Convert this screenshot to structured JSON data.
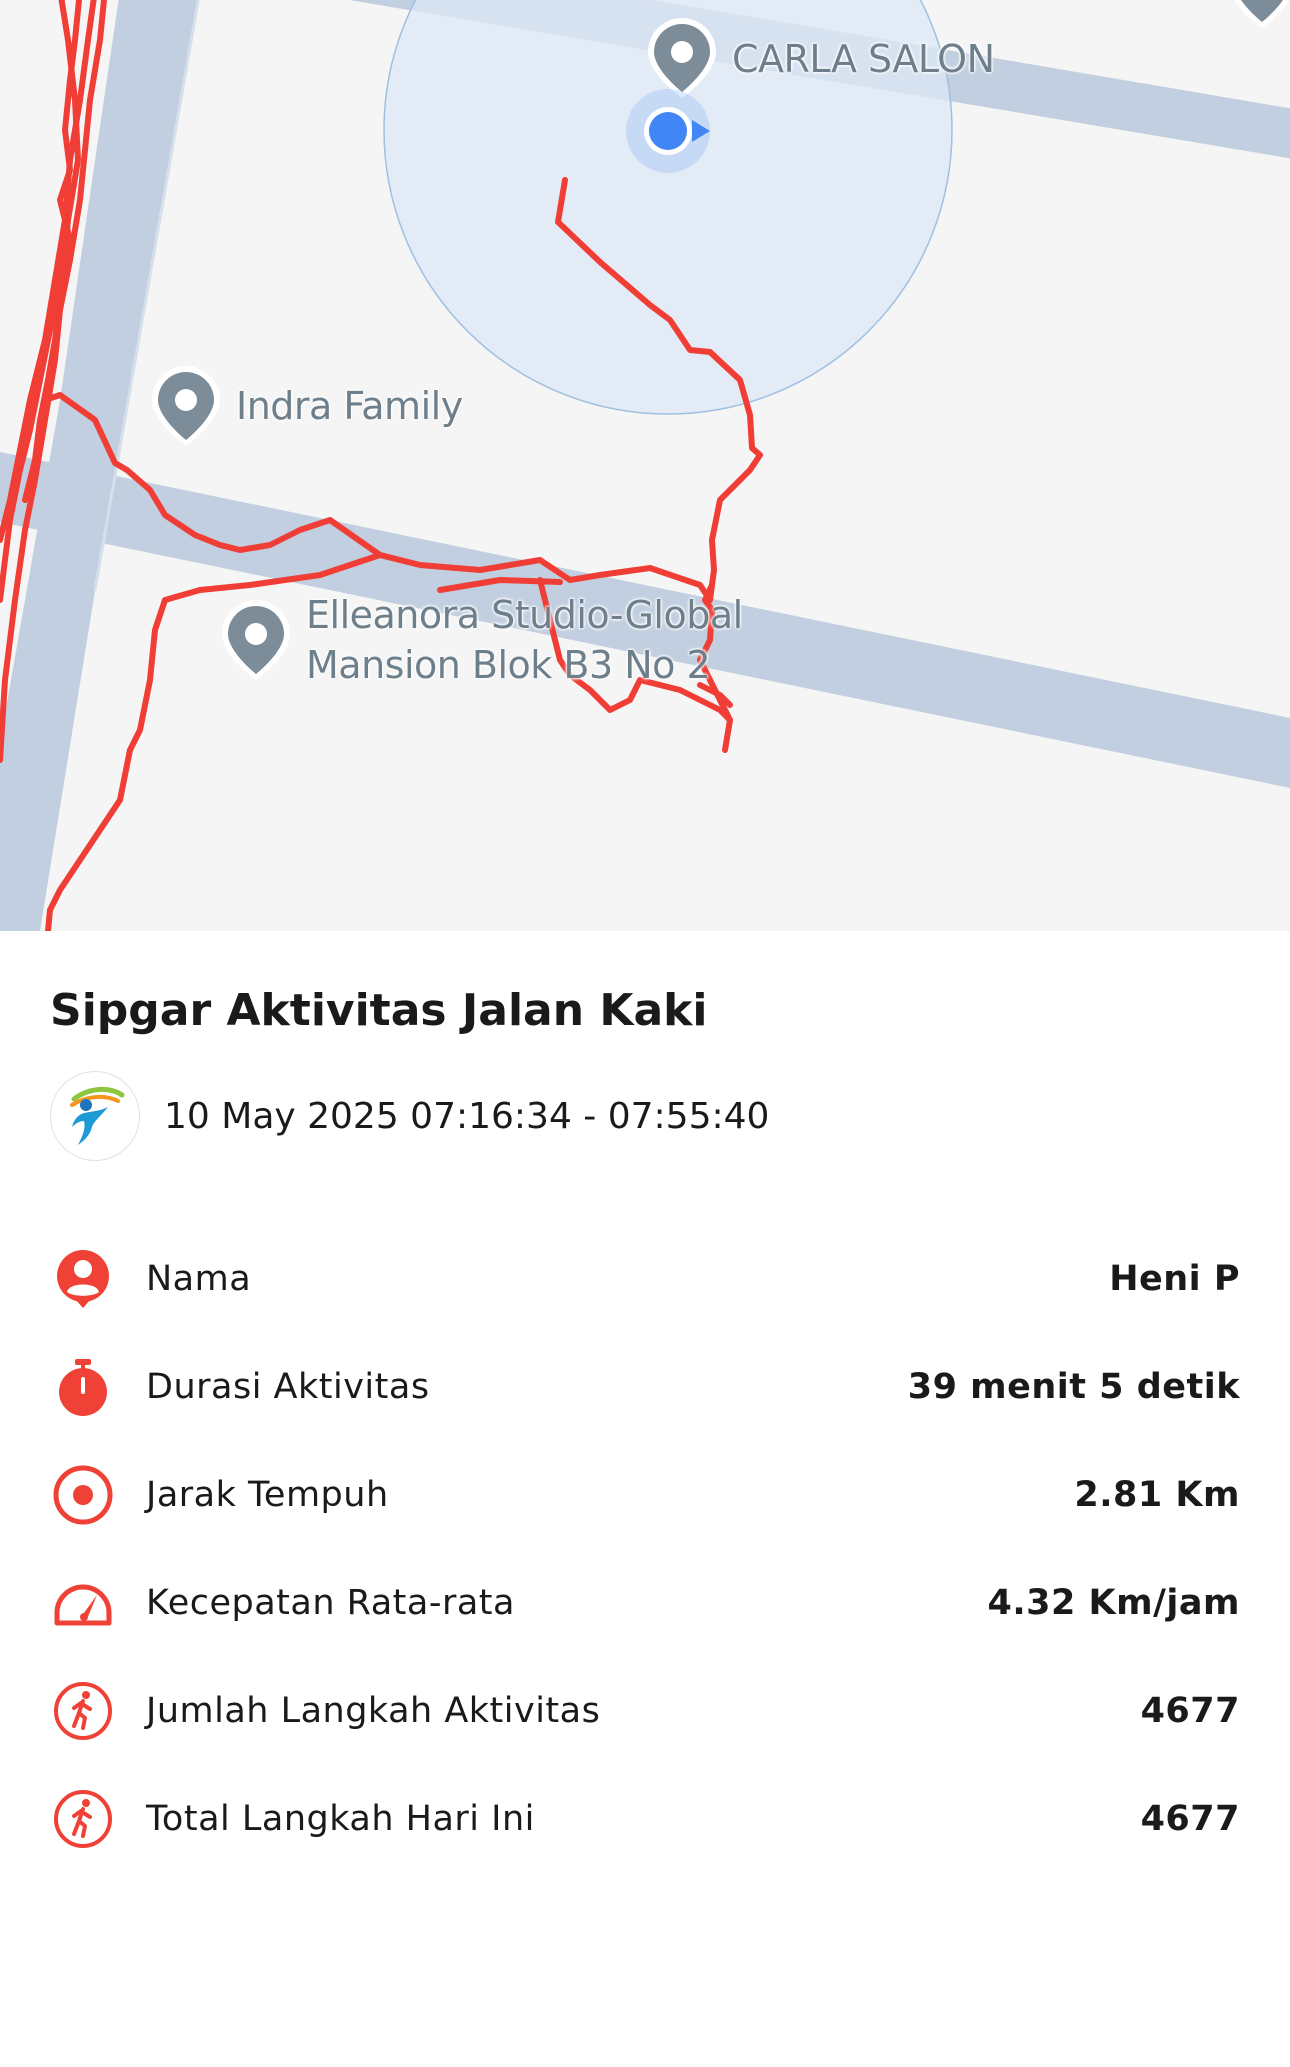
{
  "map": {
    "places": {
      "carla_salon": "CARLA SALON",
      "indra_family": "Indra Family",
      "elleanora_line1": "Elleanora Studio-Global",
      "elleanora_line2": "Mansion Blok B3 No 2"
    },
    "colors": {
      "route": "#f03e36",
      "road": "#c1cfe0",
      "accuracy_circle": "#dce8f5",
      "location_dot": "#4285f4",
      "pin": "#7c8c99"
    }
  },
  "activity": {
    "title": "Sipgar Aktivitas Jalan Kaki",
    "datetime": "10 May 2025 07:16:34 - 07:55:40",
    "stats": [
      {
        "icon": "person-pin-icon",
        "label": "Nama",
        "value": "Heni P"
      },
      {
        "icon": "stopwatch-icon",
        "label": "Durasi Aktivitas",
        "value": "39 menit 5 detik"
      },
      {
        "icon": "target-icon",
        "label": "Jarak Tempuh",
        "value": "2.81 Km"
      },
      {
        "icon": "speedometer-icon",
        "label": "Kecepatan Rata-rata",
        "value": "4.32 Km/jam"
      },
      {
        "icon": "walking-icon",
        "label": "Jumlah Langkah Aktivitas",
        "value": "4677"
      },
      {
        "icon": "walking-icon",
        "label": "Total Langkah Hari Ini",
        "value": "4677"
      }
    ],
    "accent_color": "#ef4136"
  }
}
